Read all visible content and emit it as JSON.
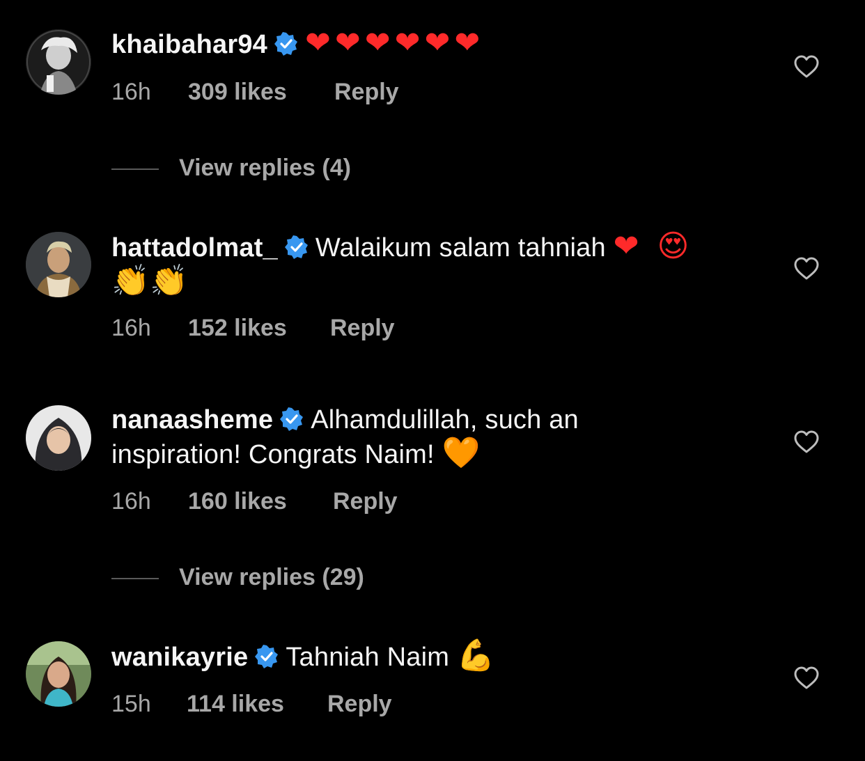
{
  "comments": [
    {
      "username": "khaibahar94",
      "text": "",
      "emoji_line1": "❤❤❤❤❤❤",
      "emoji_line2": "",
      "time": "16h",
      "likes": "309 likes",
      "reply": "Reply",
      "avatar_icon": "avatar-photo"
    },
    {
      "username": "hattadolmat_",
      "text": "Walaikum salam tahniah",
      "emoji_line1": "❤ 😍",
      "emoji_line2": "👏👏",
      "time": "16h",
      "likes": "152 likes",
      "reply": "Reply",
      "avatar_icon": "avatar-photo"
    },
    {
      "username": "nanaasheme",
      "text": "Alhamdulillah, such an",
      "text_line2": "inspiration! Congrats Naim!",
      "emoji_line1": "",
      "emoji_line2": "🧡",
      "time": "16h",
      "likes": "160 likes",
      "reply": "Reply",
      "avatar_icon": "avatar-photo"
    },
    {
      "username": "wanikayrie",
      "text": "Tahniah Naim",
      "emoji_line1": "💪",
      "emoji_line2": "",
      "time": "15h",
      "likes": "114 likes",
      "reply": "Reply",
      "avatar_icon": "avatar-photo"
    }
  ],
  "view_replies": [
    "View replies (4)",
    "View replies (29)"
  ],
  "colors": {
    "background": "#000000",
    "text": "#f5f5f5",
    "meta": "#a8a8a8",
    "verified": "#3897f0",
    "heart_red": "#ff2a2a",
    "heart_orange": "#ff8a1a"
  },
  "icons": {
    "verified": "verified-badge-icon",
    "like": "heart-outline-icon"
  }
}
